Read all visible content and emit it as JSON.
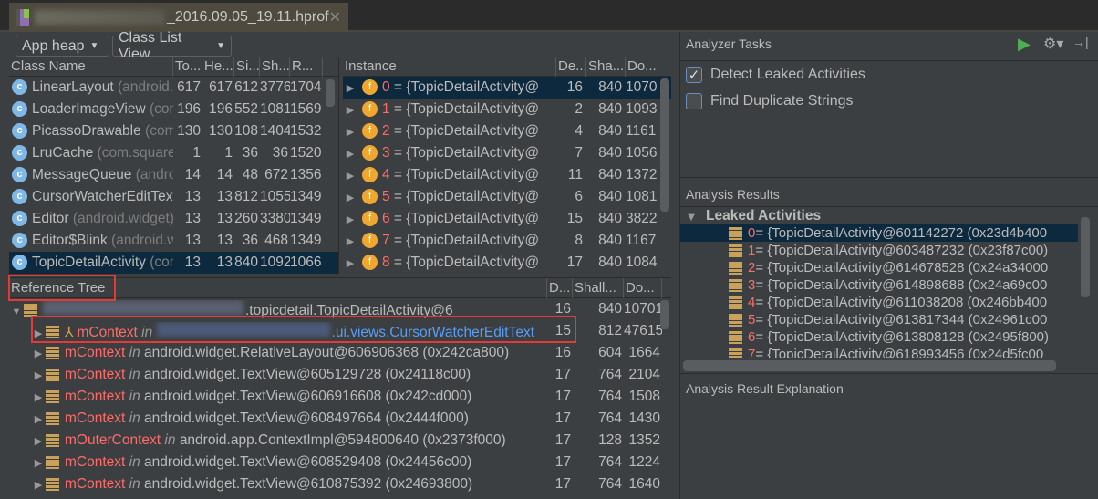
{
  "tab": {
    "title": "_2016.09.05_19.11.hprof",
    "close": "✕"
  },
  "toolbar": {
    "heap": "App heap",
    "view": "Class List View"
  },
  "class_list": {
    "columns": [
      "Class Name",
      "To...",
      "He...",
      "Si...",
      "Sh...",
      "R..."
    ],
    "rows": [
      {
        "name": "LinearLayout",
        "pkg": "(android.widget)",
        "v": [
          "617",
          "617",
          "612",
          "3776",
          "1704"
        ]
      },
      {
        "name": "LoaderImageView",
        "pkg": "(com...)",
        "v": [
          "196",
          "196",
          "552",
          "1081",
          "1569"
        ]
      },
      {
        "name": "PicassoDrawable",
        "pkg": "(com...)",
        "v": [
          "130",
          "130",
          "108",
          "1404",
          "1532"
        ]
      },
      {
        "name": "LruCache",
        "pkg": "(com.square...)",
        "v": [
          "1",
          "1",
          "36",
          "36",
          "1520"
        ]
      },
      {
        "name": "MessageQueue",
        "pkg": "(android.os)",
        "v": [
          "14",
          "14",
          "48",
          "672",
          "1356"
        ]
      },
      {
        "name": "CursorWatcherEditText",
        "pkg": "",
        "v": [
          "13",
          "13",
          "812",
          "1055",
          "1349"
        ]
      },
      {
        "name": "Editor",
        "pkg": "(android.widget)",
        "v": [
          "13",
          "13",
          "260",
          "3380",
          "1349"
        ]
      },
      {
        "name": "Editor$Blink",
        "pkg": "(android.widget)",
        "v": [
          "13",
          "13",
          "36",
          "468",
          "1349"
        ]
      },
      {
        "name": "TopicDetailActivity",
        "pkg": "(com...)",
        "v": [
          "13",
          "13",
          "840",
          "1092",
          "1066"
        ],
        "selected": true
      }
    ]
  },
  "instances": {
    "columns": [
      "Instance",
      "De...",
      "Sha...",
      "Do..."
    ],
    "rows": [
      {
        "idx": "0",
        "text": " = {TopicDetailActivity@",
        "v": [
          "16",
          "840",
          "1070"
        ],
        "selected": true
      },
      {
        "idx": "1",
        "text": " = {TopicDetailActivity@",
        "v": [
          "2",
          "840",
          "1093"
        ]
      },
      {
        "idx": "2",
        "text": " = {TopicDetailActivity@",
        "v": [
          "4",
          "840",
          "1161"
        ]
      },
      {
        "idx": "3",
        "text": " = {TopicDetailActivity@",
        "v": [
          "7",
          "840",
          "1056"
        ]
      },
      {
        "idx": "4",
        "text": " = {TopicDetailActivity@",
        "v": [
          "11",
          "840",
          "1372"
        ]
      },
      {
        "idx": "5",
        "text": " = {TopicDetailActivity@",
        "v": [
          "6",
          "840",
          "1081"
        ]
      },
      {
        "idx": "6",
        "text": " = {TopicDetailActivity@",
        "v": [
          "15",
          "840",
          "3822"
        ]
      },
      {
        "idx": "7",
        "text": " = {TopicDetailActivity@",
        "v": [
          "8",
          "840",
          "1167"
        ]
      },
      {
        "idx": "8",
        "text": " = {TopicDetailActivity@",
        "v": [
          "17",
          "840",
          "1084"
        ]
      }
    ]
  },
  "reference_tree": {
    "columns": [
      "Reference Tree",
      "D...",
      "Shall...",
      "Do..."
    ],
    "root": {
      "text": ".topicdetail.TopicDetailActivity@6",
      "v": [
        "16",
        "840",
        "10701"
      ]
    },
    "rows": [
      {
        "field": "mContext",
        "in": "in",
        "obj": ".ui.views.CursorWatcherEditText",
        "v": [
          "15",
          "812",
          "47615"
        ],
        "highlight": true
      },
      {
        "field": "mContext",
        "in": "in",
        "obj": "android.widget.RelativeLayout@606906368 (0x242ca800)",
        "v": [
          "16",
          "604",
          "1664"
        ]
      },
      {
        "field": "mContext",
        "in": "in",
        "obj": "android.widget.TextView@605129728 (0x24118c00)",
        "v": [
          "17",
          "764",
          "2104"
        ]
      },
      {
        "field": "mContext",
        "in": "in",
        "obj": "android.widget.TextView@606916608 (0x242cd000)",
        "v": [
          "17",
          "764",
          "1508"
        ]
      },
      {
        "field": "mContext",
        "in": "in",
        "obj": "android.widget.TextView@608497664 (0x2444f000)",
        "v": [
          "17",
          "764",
          "1430"
        ]
      },
      {
        "field": "mOuterContext",
        "in": "in",
        "obj": "android.app.ContextImpl@594800640 (0x2373f000)",
        "v": [
          "17",
          "128",
          "1352"
        ]
      },
      {
        "field": "mContext",
        "in": "in",
        "obj": "android.widget.TextView@608529408 (0x24456c00)",
        "v": [
          "17",
          "764",
          "1224"
        ]
      },
      {
        "field": "mContext",
        "in": "in",
        "obj": "android.widget.TextView@610875392 (0x24693800)",
        "v": [
          "17",
          "764",
          "1640"
        ]
      }
    ]
  },
  "analyzer": {
    "title": "Analyzer Tasks",
    "tasks": [
      {
        "label": "Detect Leaked Activities",
        "checked": true
      },
      {
        "label": "Find Duplicate Strings",
        "checked": false
      }
    ],
    "results_title": "Analysis Results",
    "group": "Leaked Activities",
    "results": [
      {
        "idx": "0",
        "text": " = {TopicDetailActivity@601142272 (0x23d4b400",
        "selected": true
      },
      {
        "idx": "1",
        "text": " = {TopicDetailActivity@603487232 (0x23f87c00)"
      },
      {
        "idx": "2",
        "text": " = {TopicDetailActivity@614678528 (0x24a34000"
      },
      {
        "idx": "3",
        "text": " = {TopicDetailActivity@614898688 (0x24a69c00"
      },
      {
        "idx": "4",
        "text": " = {TopicDetailActivity@611038208 (0x246bb400"
      },
      {
        "idx": "5",
        "text": " = {TopicDetailActivity@613817344 (0x24961c00"
      },
      {
        "idx": "6",
        "text": " = {TopicDetailActivity@613808128 (0x2495f800)"
      },
      {
        "idx": "7",
        "text": " = {TopicDetailActivity@618993456 (0x24d5fc00"
      }
    ],
    "explanation_title": "Analysis Result Explanation"
  },
  "colors": {
    "selection": "#0d293e",
    "index": "#ff6b68",
    "link": "#589df6",
    "highlight_box": "#e53935",
    "run": "#4caf50"
  }
}
